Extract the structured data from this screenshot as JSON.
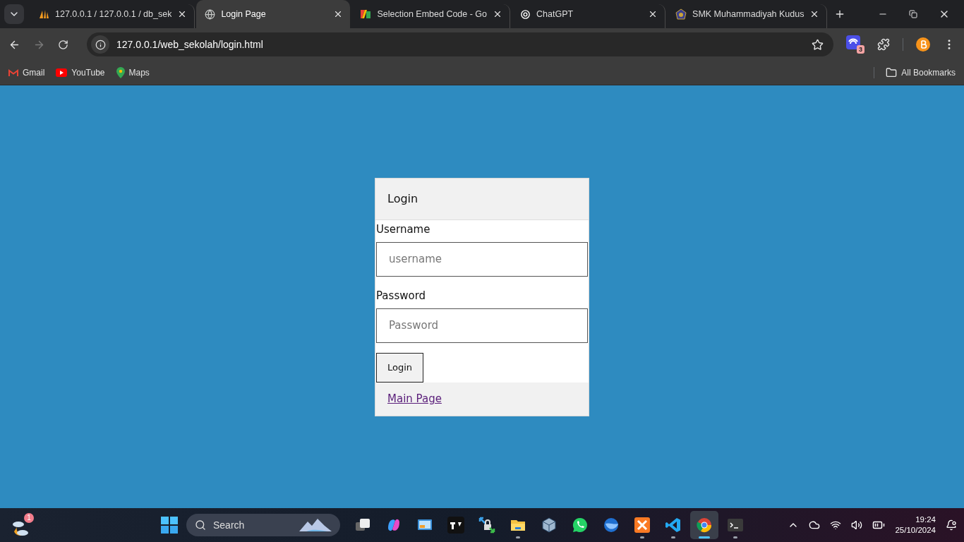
{
  "browser": {
    "tabs": [
      {
        "title": "127.0.0.1 / 127.0.0.1 / db_sek",
        "kind": "sail",
        "selected": false
      },
      {
        "title": "Login Page",
        "kind": "globe",
        "selected": true
      },
      {
        "title": "Selection Embed Code - Go",
        "kind": "blocks",
        "selected": false
      },
      {
        "title": "ChatGPT",
        "kind": "knot",
        "selected": false
      },
      {
        "title": "SMK Muhammadiyah Kudus",
        "kind": "emblem",
        "selected": false
      }
    ],
    "address": "127.0.0.1/web_sekolah/login.html",
    "extension_badge": "3",
    "bookmarks": [
      {
        "label": "Gmail",
        "kind": "mail"
      },
      {
        "label": "YouTube",
        "kind": "play"
      },
      {
        "label": "Maps",
        "kind": "pin"
      }
    ],
    "all_bookmarks": "All Bookmarks"
  },
  "login": {
    "title": "Login",
    "fields": [
      {
        "label": "Username",
        "placeholder": "username"
      },
      {
        "label": "Password",
        "placeholder": "Password"
      }
    ],
    "button": "Login",
    "link": "Main Page"
  },
  "taskbar": {
    "weather_badge": "1",
    "search_placeholder": "Search",
    "apps": [
      {
        "kind": "taskview",
        "open": false,
        "selected": false
      },
      {
        "kind": "swirl",
        "open": false,
        "selected": false
      },
      {
        "kind": "monitor",
        "open": false,
        "selected": false
      },
      {
        "kind": "chartlogo",
        "open": false,
        "selected": false
      },
      {
        "kind": "lock",
        "open": false,
        "selected": false
      },
      {
        "kind": "folder",
        "open": true,
        "selected": false
      },
      {
        "kind": "cube",
        "open": false,
        "selected": false
      },
      {
        "kind": "phone",
        "open": false,
        "selected": false
      },
      {
        "kind": "sphere",
        "open": false,
        "selected": false
      },
      {
        "kind": "xampp",
        "open": true,
        "selected": false
      },
      {
        "kind": "code",
        "open": true,
        "selected": false
      },
      {
        "kind": "chrome",
        "open": true,
        "selected": true
      },
      {
        "kind": "terminal",
        "open": true,
        "selected": false
      }
    ],
    "time": "19:24",
    "date": "25/10/2024"
  }
}
